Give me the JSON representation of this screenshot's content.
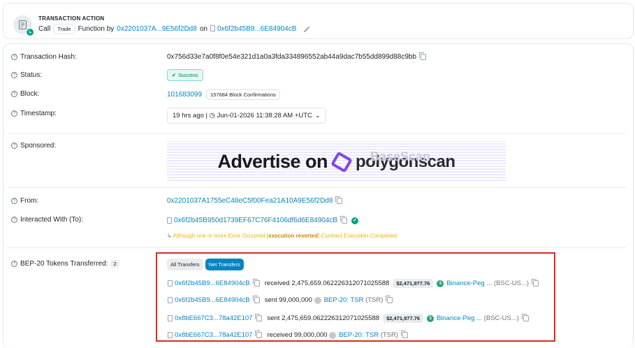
{
  "action": {
    "heading": "TRANSACTION ACTION",
    "call_word": "Call",
    "method_badge": "Trade",
    "function_by": "Function by",
    "from_short": "0x2201037A...9E56f2Dd8",
    "on_word": "on",
    "contract_short": "0x6f2b45B9...6E84904cB"
  },
  "labels": {
    "hash": "Transaction Hash:",
    "status": "Status:",
    "block": "Block:",
    "timestamp": "Timestamp:",
    "sponsored": "Sponsored:",
    "from": "From:",
    "interacted": "Interacted With (To):",
    "tokens": "BEP-20 Tokens Transferred:"
  },
  "values": {
    "hash": "0x756d33e7a0f8f0e54e321d1a0a3fda334896552ab44a9dac7b55dd899d88c9bb",
    "status": "Success",
    "block": "101683099",
    "confirmations": "157684 Block Confirmations",
    "timestamp": "19 hrs ago | ◷ Jun-01-2026 11:38:28 AM +UTC",
    "from": "0x2201037A1755eC48eC5f00Fea21A10A9E56f2Dd8",
    "to": "0x6f2b45B950d1739EF67C76F4106df6d6E84904cB",
    "warning_pre": "Although one or more Error Occurred [",
    "warning_bold": "execution reverted",
    "warning_post": "] Contract Execution Completed",
    "tokens_count": "2"
  },
  "ad": {
    "text": "Advertise on",
    "brand": "polygonscan",
    "ghost": "BaseScan"
  },
  "tabs": [
    "All Transfers",
    "Net Transfers"
  ],
  "transfers": [
    {
      "addr": "0x6f2b45B9...6E84904cB",
      "verb": "received",
      "amount": "2,475,659.062226312071025588",
      "usd": "$2,471,977.76",
      "token": "Binance-Peg ...",
      "symbol": "(BSC-US...)"
    },
    {
      "addr": "0x6f2b45B9...6E84904cB",
      "verb": "sent",
      "amount": "99,000,000",
      "usd": "",
      "token": "BEP-20: TSR",
      "symbol": "(TSR)"
    },
    {
      "addr": "0x8bE667C3...78a42E107",
      "verb": "sent",
      "amount": "2,475,659.062226312071025588",
      "usd": "$2,471,977.76",
      "token": "Binance-Peg ...",
      "symbol": "(BSC-US...)"
    },
    {
      "addr": "0x8bE667C3...78a42E107",
      "verb": "received",
      "amount": "99,000,000",
      "usd": "",
      "token": "BEP-20: TSR",
      "symbol": "(TSR)"
    }
  ],
  "colors": {
    "link": "#0784c3",
    "success": "#00a186",
    "highlight": "#e0291b"
  }
}
